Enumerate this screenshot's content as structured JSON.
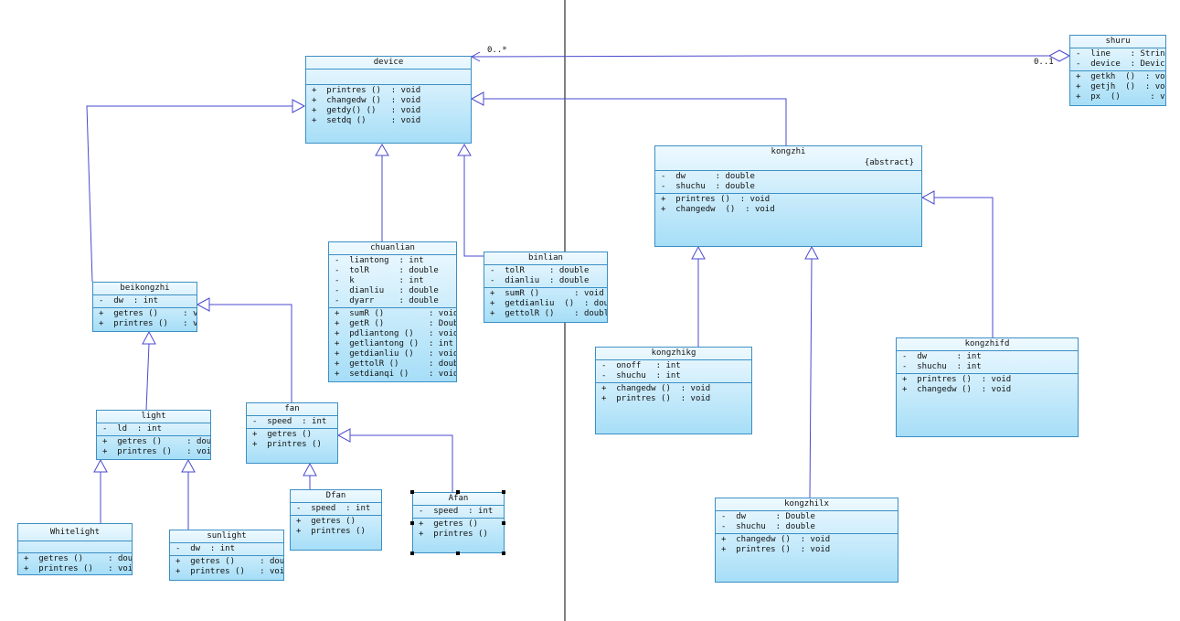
{
  "classes": {
    "device": {
      "name": "device",
      "attrs": [],
      "ops": [
        "+  printres ()  : void",
        "+  changedw ()  : void",
        "+  getdy() ()   : void",
        "+  setdq ()     : void"
      ]
    },
    "shuru": {
      "name": "shuru",
      "attrs": [
        "-  line    : String",
        "-  device  : Device"
      ],
      "ops": [
        "+  getkh  ()  : void",
        "+  getjh  ()  : void",
        "+  px  ()      : void"
      ]
    },
    "kongzhi": {
      "name": "kongzhi",
      "stereotype": "{abstract}",
      "attrs": [
        "-  dw      : double",
        "-  shuchu  : double"
      ],
      "ops": [
        "+  printres ()  : void",
        "+  changedw  ()  : void"
      ]
    },
    "chuanlian": {
      "name": "chuanlian",
      "attrs": [
        "-  liantong  : int",
        "-  tolR      : double",
        "-  k         : int",
        "-  dianliu   : double",
        "-  dyarr     : double"
      ],
      "ops": [
        "+  sumR ()         : void",
        "+  getR ()         : Double",
        "+  pdliantong ()   : void",
        "+  getliantong ()  : int",
        "+  getdianliu ()   : void",
        "+  gettolR ()      : double",
        "+  setdianqi ()    : void"
      ]
    },
    "binlian": {
      "name": "binlian",
      "attrs": [
        "-  tolR     : double",
        "-  dianliu  : double"
      ],
      "ops": [
        "+  sumR ()       : void",
        "+  getdianliu  ()  : double",
        "+  gettolR ()    : double"
      ]
    },
    "beikongzhi": {
      "name": "beikongzhi",
      "attrs": [
        "-  dw  : int"
      ],
      "ops": [
        "+  getres ()     : void",
        "+  printres ()   : void"
      ]
    },
    "light": {
      "name": "light",
      "attrs": [
        "-  ld  : int"
      ],
      "ops": [
        "+  getres ()     : double",
        "+  printres ()   : void"
      ]
    },
    "fan": {
      "name": "fan",
      "attrs": [
        "-  speed  : int"
      ],
      "ops": [
        "+  getres ()     : do",
        "+  printres ()   : vo"
      ]
    },
    "Dfan": {
      "name": "Dfan",
      "attrs": [
        "-  speed  : int"
      ],
      "ops": [
        "+  getres ()     : do",
        "+  printres ()   : vo"
      ]
    },
    "Afan": {
      "name": "Afan",
      "attrs": [
        "-  speed  : int"
      ],
      "ops": [
        "+  getres ()     : do",
        "+  printres ()   : vo"
      ]
    },
    "Whitelight": {
      "name": "Whitelight",
      "attrs": [],
      "ops": [
        "+  getres ()     : double",
        "+  printres ()   : void"
      ]
    },
    "sunlight": {
      "name": "sunlight",
      "attrs": [
        "-  dw  : int"
      ],
      "ops": [
        "+  getres ()     : double",
        "+  printres ()   : void"
      ]
    },
    "kongzhikg": {
      "name": "kongzhikg",
      "attrs": [
        "-  onoff   : int",
        "-  shuchu  : int"
      ],
      "ops": [
        "+  changedw ()  : void",
        "+  printres ()  : void"
      ]
    },
    "kongzhifd": {
      "name": "kongzhifd",
      "attrs": [
        "-  dw      : int",
        "-  shuchu  : int"
      ],
      "ops": [
        "+  printres ()  : void",
        "+  changedw ()  : void"
      ]
    },
    "kongzhilx": {
      "name": "kongzhilx",
      "attrs": [
        "-  dw      : Double",
        "-  shuchu  : double"
      ],
      "ops": [
        "+  changedw ()  : void",
        "+  printres ()  : void"
      ]
    }
  },
  "multiplicities": {
    "device_end": "0..*",
    "shuru_end": "0..1"
  },
  "colors": {
    "line": "#4a4ad0",
    "border": "#3c8fc4",
    "fill_top": "#eef9ff",
    "fill_bottom": "#a6def7",
    "divider": "#000000"
  }
}
